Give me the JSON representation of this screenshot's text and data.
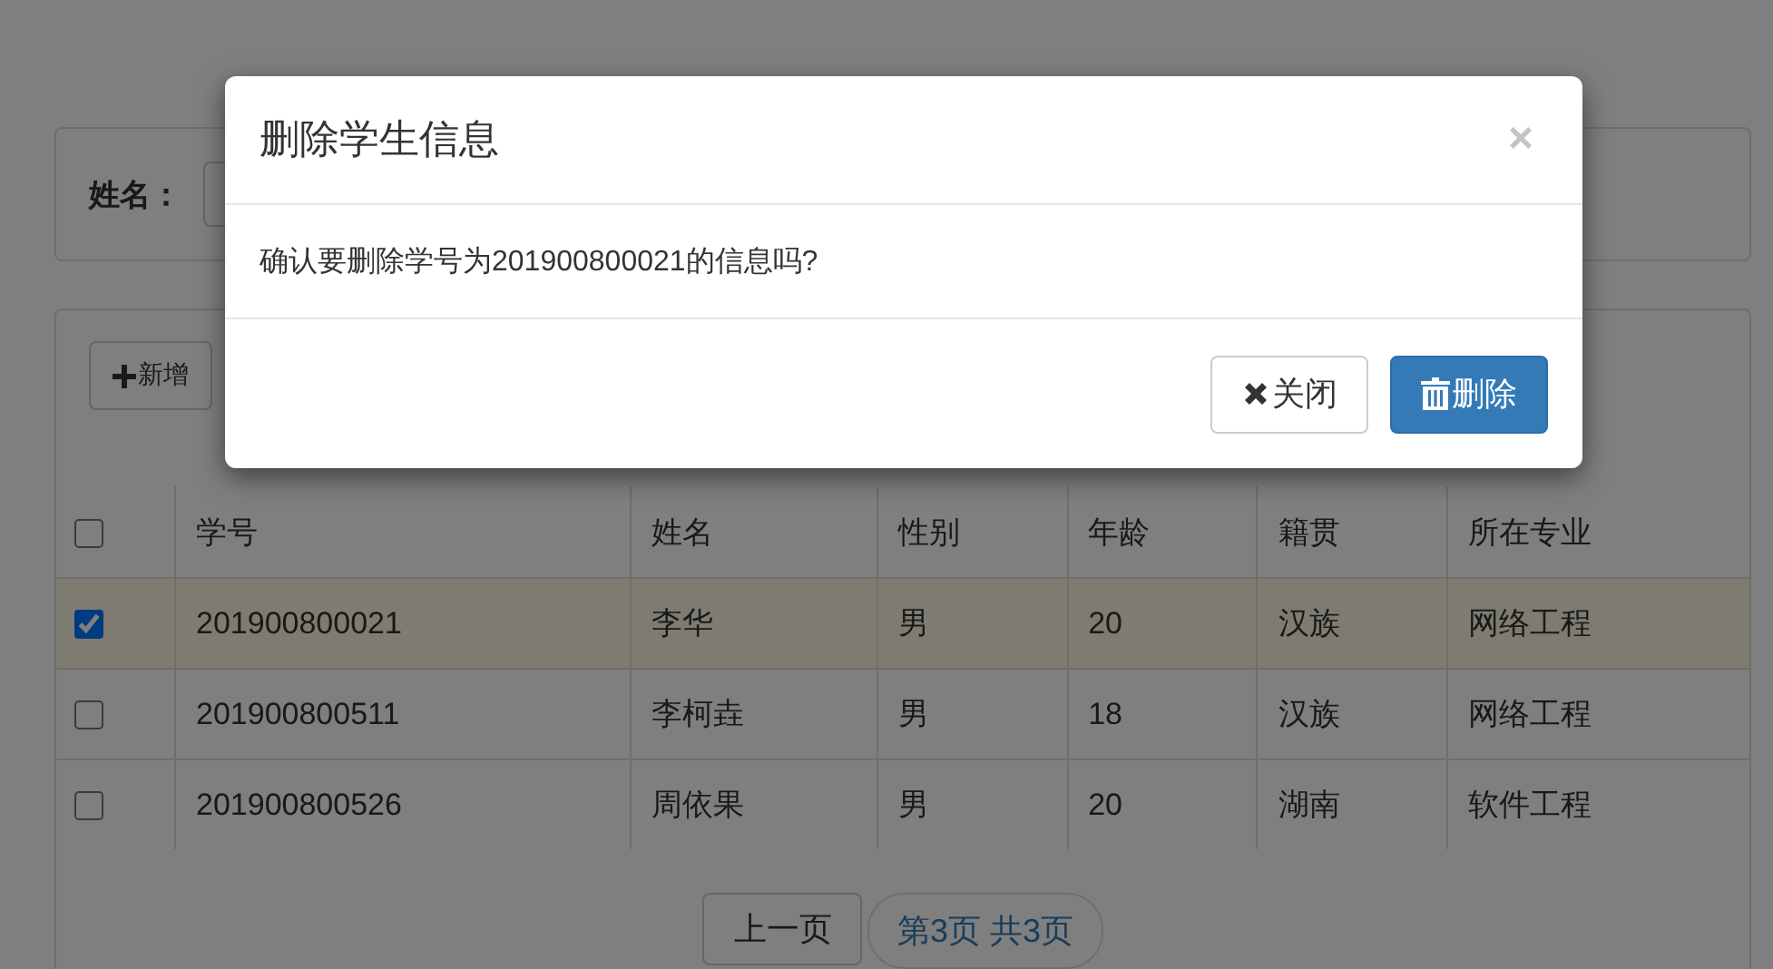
{
  "search": {
    "label": "姓名："
  },
  "toolbar": {
    "add_button": "新增"
  },
  "table": {
    "select_all": {
      "checked": false
    },
    "columns": [
      "学号",
      "姓名",
      "性别",
      "年龄",
      "籍贯",
      "所在专业"
    ],
    "rows": [
      {
        "selected": true,
        "cells": [
          "201900800021",
          "李华",
          "男",
          "20",
          "汉族",
          "网络工程"
        ]
      },
      {
        "selected": false,
        "cells": [
          "201900800511",
          "李柯垚",
          "男",
          "18",
          "汉族",
          "网络工程"
        ]
      },
      {
        "selected": false,
        "cells": [
          "201900800526",
          "周依果",
          "男",
          "20",
          "湖南",
          "软件工程"
        ]
      }
    ]
  },
  "pager": {
    "prev": "上一页",
    "info": "第3页 共3页"
  },
  "dialog": {
    "title": "删除学生信息",
    "close": "×",
    "message": "确认要删除学号为201900800021的信息吗?",
    "buttons": [
      {
        "kind": "default",
        "label": "关闭"
      },
      {
        "kind": "danger",
        "label": "删除"
      }
    ]
  }
}
